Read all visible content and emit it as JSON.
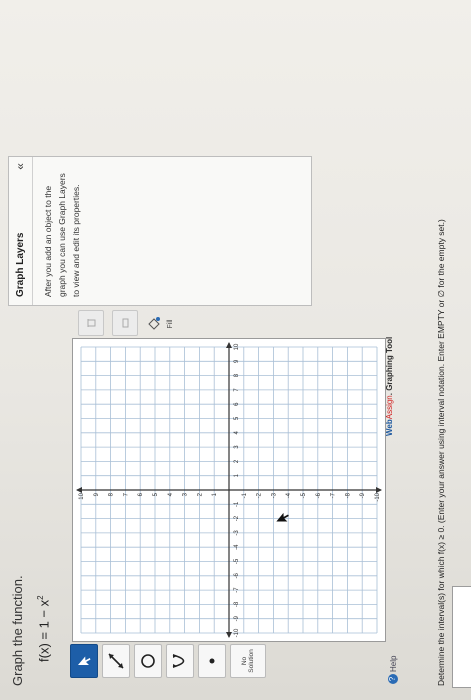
{
  "question": {
    "instruction": "Graph the function.",
    "function_label": "f(x) = 1 − x",
    "function_exponent": "2",
    "interval_prompt": "Determine the interval(s) for which f(x) ≥ 0. (Enter your answer using interval notation. Enter EMPTY or ∅ for the empty set.)",
    "answer_value": ""
  },
  "toolbar": {
    "tools": [
      {
        "name": "pointer-tool",
        "icon": "arrow-cursor-icon",
        "active": true
      },
      {
        "name": "line-tool",
        "icon": "line-segment-icon",
        "active": false
      },
      {
        "name": "circle-tool",
        "icon": "circle-icon",
        "active": false
      },
      {
        "name": "parabola-tool",
        "icon": "parabola-icon",
        "active": false
      },
      {
        "name": "point-tool",
        "icon": "point-icon",
        "active": false
      }
    ],
    "no_solution_label": "No Solution",
    "help_label": "Help"
  },
  "graph": {
    "x_range": [
      -10,
      10
    ],
    "y_range": [
      -10,
      10
    ],
    "grid": true,
    "x_ticks": [
      "-10",
      "-9",
      "-8",
      "-7",
      "-6",
      "-5",
      "-4",
      "-3",
      "-2",
      "-1",
      "1",
      "2",
      "3",
      "4",
      "5",
      "6",
      "7",
      "8",
      "9",
      "10"
    ],
    "y_ticks": [
      "10",
      "9",
      "8",
      "7",
      "6",
      "5",
      "4",
      "3",
      "2",
      "1",
      "-1",
      "-2",
      "-3",
      "-4",
      "-5",
      "-6",
      "-7",
      "-8",
      "-9",
      "-10"
    ],
    "axis_color": "#333333",
    "grid_color": "#a9bfd6"
  },
  "branding": {
    "web": "Web",
    "assign": "Assign",
    "tool": ". Graphing Tool"
  },
  "right_tools": {
    "fill_label": "Fill"
  },
  "layers_panel": {
    "title": "Graph Layers",
    "collapse_icon": "«",
    "description": "After you add an object to the graph you can use Graph Layers to view and edit its properties."
  }
}
